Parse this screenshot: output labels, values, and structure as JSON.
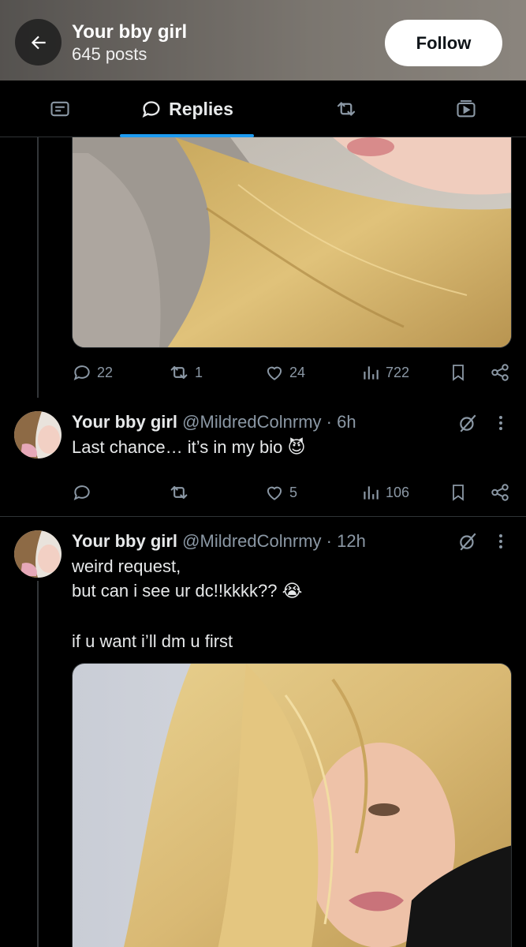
{
  "header": {
    "name": "Your bby girl",
    "posts": "645 posts",
    "follow_label": "Follow"
  },
  "tabs": [
    {
      "label": "",
      "icon": "articles-icon"
    },
    {
      "label": "Replies",
      "icon": "reply-bubble-icon",
      "active": true
    },
    {
      "label": "",
      "icon": "retweet-icon"
    },
    {
      "label": "",
      "icon": "media-icon"
    }
  ],
  "tweet1": {
    "stats": {
      "replies": "22",
      "retweets": "1",
      "likes": "24",
      "views": "722"
    }
  },
  "tweet2": {
    "name": "Your bby girl",
    "handle": "@MildredColnrmy",
    "sep": "·",
    "time": "6h",
    "text": "Last chance… it’s in my bio 😈",
    "stats": {
      "replies": "",
      "retweets": "",
      "likes": "5",
      "views": "106"
    }
  },
  "tweet3": {
    "name": "Your bby girl",
    "handle": "@MildredColnrmy",
    "sep": "·",
    "time": "12h",
    "line1": "weird request,",
    "line2": "but can i see ur dc!!kkkk?? 😭",
    "line3": "if u want i’ll dm u first"
  },
  "colors": {
    "accent": "#1d9bf0",
    "muted": "#8b98a5",
    "background": "#000000"
  }
}
